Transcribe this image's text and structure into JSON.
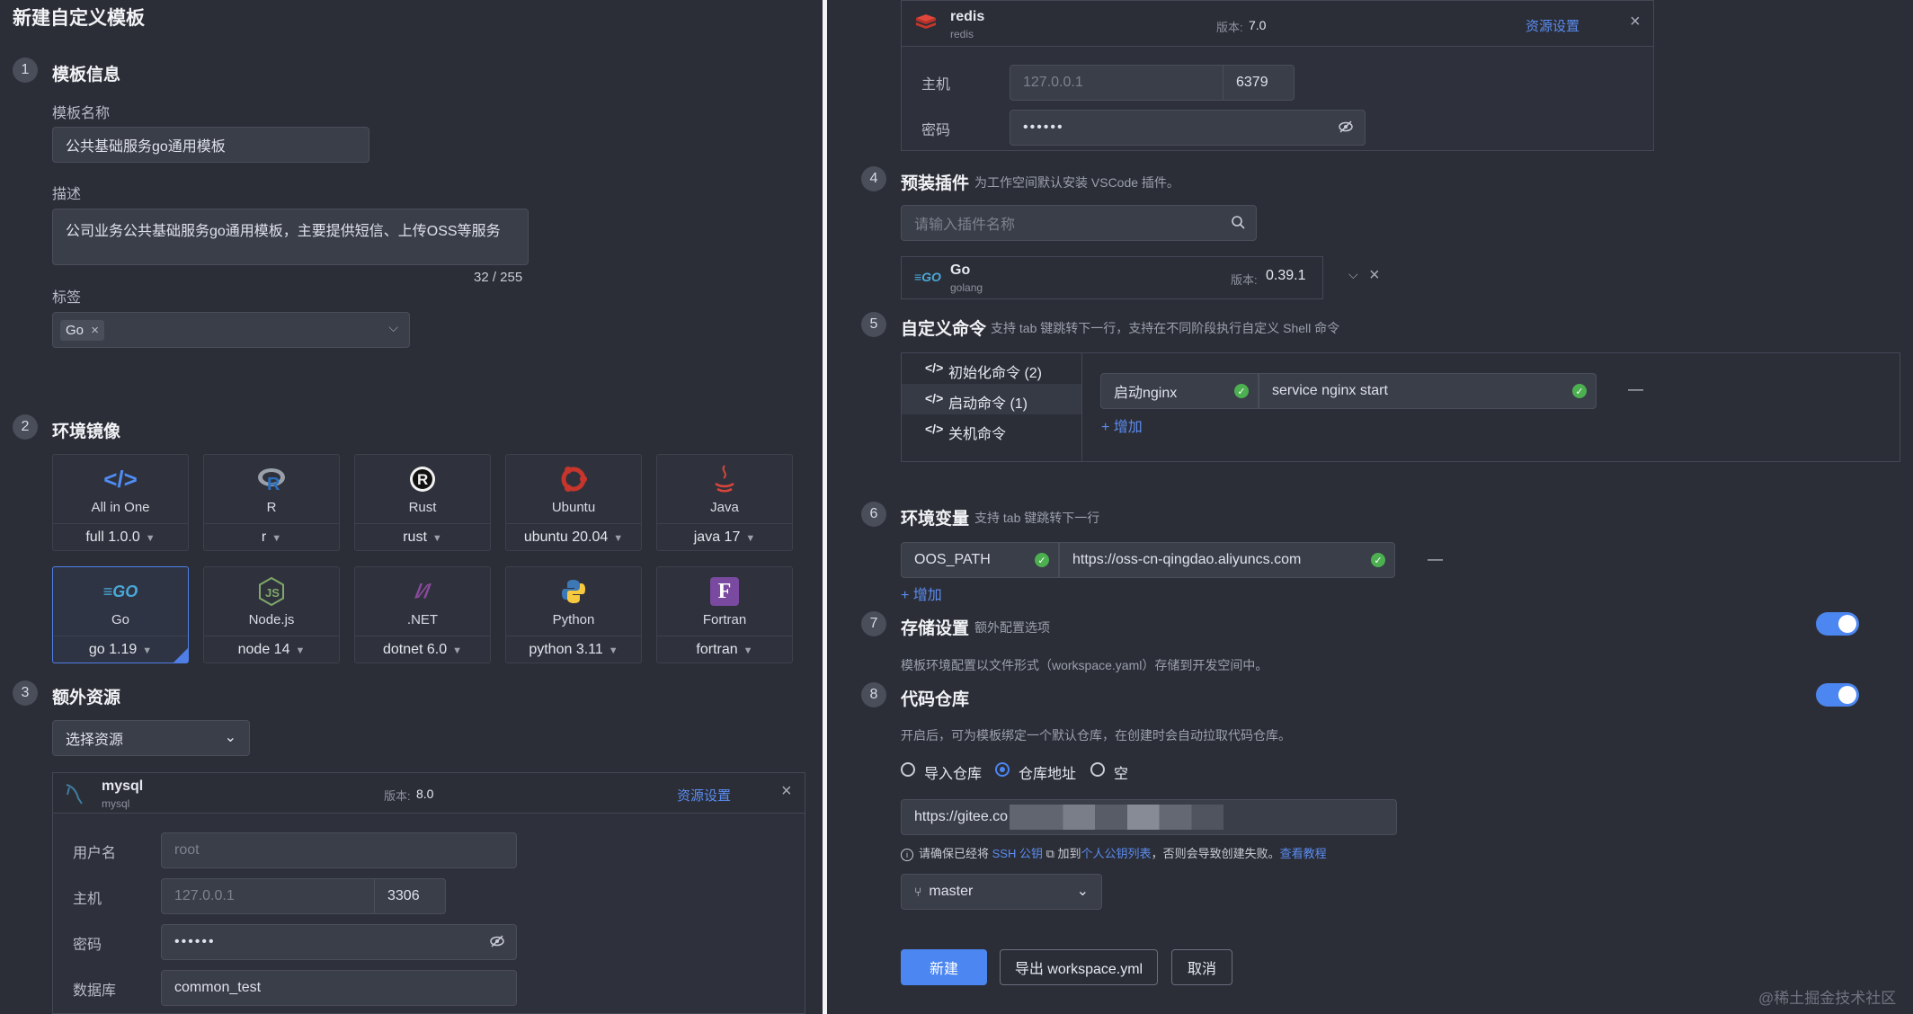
{
  "left": {
    "title": "新建自定义模板",
    "step1": {
      "num": "1",
      "title": "模板信息",
      "name_label": "模板名称",
      "name_value": "公共基础服务go通用模板",
      "desc_label": "描述",
      "desc_value": "公司业务公共基础服务go通用模板，主要提供短信、上传OSS等服务",
      "desc_count": "32 / 255",
      "tags_label": "标签",
      "tag": "Go",
      "tag_remove": "×"
    },
    "step2": {
      "num": "2",
      "title": "环境镜像",
      "images": [
        {
          "name": "All in One",
          "version": "full 1.0.0",
          "icon": "code-icon"
        },
        {
          "name": "R",
          "version": "r",
          "icon": "r-lang-icon"
        },
        {
          "name": "Rust",
          "version": "rust",
          "icon": "rust-icon"
        },
        {
          "name": "Ubuntu",
          "version": "ubuntu 20.04",
          "icon": "ubuntu-icon"
        },
        {
          "name": "Java",
          "version": "java 17",
          "icon": "java-icon"
        },
        {
          "name": "Go",
          "version": "go 1.19",
          "icon": "go-icon",
          "selected": true
        },
        {
          "name": "Node.js",
          "version": "node 14",
          "icon": "nodejs-icon"
        },
        {
          "name": ".NET",
          "version": "dotnet 6.0",
          "icon": "dotnet-icon"
        },
        {
          "name": "Python",
          "version": "python 3.11",
          "icon": "python-icon"
        },
        {
          "name": "Fortran",
          "version": "fortran",
          "icon": "fortran-icon"
        }
      ]
    },
    "step3": {
      "num": "3",
      "title": "额外资源",
      "select_label": "选择资源",
      "mysql": {
        "name": "mysql",
        "sub": "mysql",
        "version_label": "版本:",
        "version": "8.0",
        "settings": "资源设置",
        "user_label": "用户名",
        "user_placeholder": "root",
        "host_label": "主机",
        "host_placeholder": "127.0.0.1",
        "port": "3306",
        "pwd_label": "密码",
        "pwd_value": "••••••",
        "db_label": "数据库",
        "db_value": "common_test"
      }
    }
  },
  "right": {
    "redis": {
      "name": "redis",
      "sub": "redis",
      "version_label": "版本:",
      "version": "7.0",
      "settings": "资源设置",
      "host_label": "主机",
      "host_placeholder": "127.0.0.1",
      "port": "6379",
      "pwd_label": "密码",
      "pwd_value": "••••••"
    },
    "step4": {
      "num": "4",
      "title": "预装插件",
      "sub": "为工作空间默认安装 VSCode 插件。",
      "search_placeholder": "请输入插件名称",
      "plugin": {
        "name": "Go",
        "sub": "golang",
        "version_label": "版本:",
        "version": "0.39.1"
      }
    },
    "step5": {
      "num": "5",
      "title": "自定义命令",
      "sub": "支持 tab 键跳转下一行，支持在不同阶段执行自定义 Shell 命令",
      "menu": [
        "初始化命令 (2)",
        "启动命令 (1)",
        "关机命令"
      ],
      "cmd_name": "启动nginx",
      "cmd_value": "service nginx start",
      "add": "+ 增加",
      "remove": "—"
    },
    "step6": {
      "num": "6",
      "title": "环境变量",
      "sub": "支持 tab 键跳转下一行",
      "key": "OOS_PATH",
      "value": "https://oss-cn-qingdao.aliyuncs.com",
      "add": "+ 增加",
      "remove": "—"
    },
    "step7": {
      "num": "7",
      "title": "存储设置",
      "sub": "额外配置选项",
      "desc": "模板环境配置以文件形式（workspace.yaml）存储到开发空间中。",
      "enabled": true
    },
    "step8": {
      "num": "8",
      "title": "代码仓库",
      "enabled": true,
      "desc": "开启后，可为模板绑定一个默认仓库，在创建时会自动拉取代码仓库。",
      "radios": [
        "导入仓库",
        "仓库地址",
        "空"
      ],
      "repo_url": "https://gitee.co",
      "note_pre": "请确保已经将",
      "note_link1": "SSH 公钥",
      "note_mid": "加到",
      "note_link2": "个人公钥列表",
      "note_post": "，否则会导致创建失败。",
      "note_link3": "查看教程",
      "branch": "master"
    },
    "buttons": {
      "create": "新建",
      "export": "导出 workspace.yml",
      "cancel": "取消"
    },
    "watermark": "@稀土掘金技术社区"
  }
}
